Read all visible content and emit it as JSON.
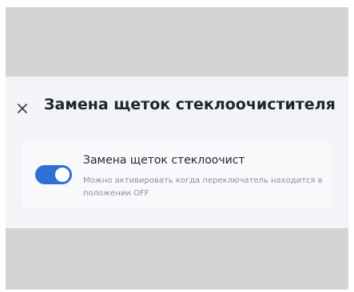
{
  "dialog": {
    "title": "Замена щеток стеклоочистителя",
    "close_icon": "close-icon"
  },
  "option": {
    "title": "Замена щеток стеклоочист",
    "description": "Можно активировать когда переключатель находится в положении OFF",
    "toggle_on": true,
    "accent_color": "#2f6fd6"
  }
}
